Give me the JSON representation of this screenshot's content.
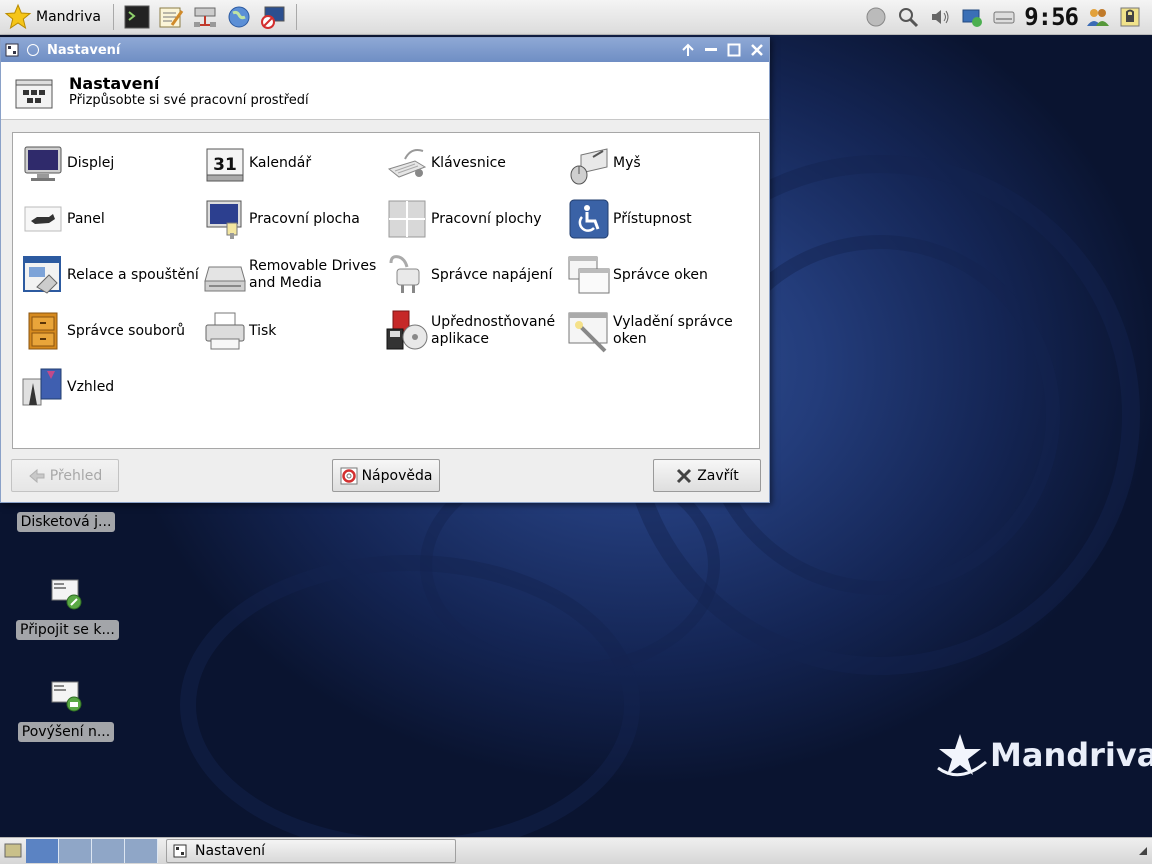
{
  "top_panel": {
    "menu_label": "Mandriva",
    "launchers": [
      "terminal-icon",
      "text-editor-icon",
      "network-tool-icon",
      "web-browser-icon",
      "remote-desktop-icon"
    ],
    "tray_icons": [
      "network-status-icon",
      "search-icon",
      "volume-icon",
      "updates-icon",
      "drive-icon"
    ],
    "clock": "9:56",
    "extra_tray": [
      "users-icon",
      "lock-screen-icon"
    ]
  },
  "window": {
    "title": "Nastavení",
    "header_title": "Nastavení",
    "header_subtitle": "Přizpůsobte si své pracovní prostředí",
    "items": [
      {
        "label": "Displej",
        "icon": "display-icon"
      },
      {
        "label": "Kalendář",
        "icon": "calendar-icon",
        "icon_text": "31"
      },
      {
        "label": "Klávesnice",
        "icon": "keyboard-icon"
      },
      {
        "label": "Myš",
        "icon": "mouse-icon"
      },
      {
        "label": "Panel",
        "icon": "panel-icon"
      },
      {
        "label": "Pracovní plocha",
        "icon": "desktop-icon"
      },
      {
        "label": "Pracovní plochy",
        "icon": "workspaces-icon"
      },
      {
        "label": "Přístupnost",
        "icon": "accessibility-icon"
      },
      {
        "label": "Relace a spouštění",
        "icon": "session-icon"
      },
      {
        "label": "Removable Drives and Media",
        "icon": "removable-drive-icon"
      },
      {
        "label": "Správce napájení",
        "icon": "power-plug-icon"
      },
      {
        "label": "Správce oken",
        "icon": "window-manager-icon"
      },
      {
        "label": "Správce souborů",
        "icon": "file-cabinet-icon"
      },
      {
        "label": "Tisk",
        "icon": "printer-icon"
      },
      {
        "label": "Upřednostňované aplikace",
        "icon": "preferred-apps-icon"
      },
      {
        "label": "Vyladění správce oken",
        "icon": "wm-tweaks-icon"
      },
      {
        "label": "Vzhled",
        "icon": "appearance-icon"
      }
    ],
    "buttons": {
      "overview": "Přehled",
      "help": "Nápověda",
      "close": "Zavřít"
    }
  },
  "desktop_icons": [
    {
      "label": "Disketová j...",
      "icon": "floppy-icon"
    },
    {
      "label": "Připojit se k...",
      "icon": "connect-icon"
    },
    {
      "label": "Povýšení n...",
      "icon": "upgrade-icon"
    }
  ],
  "brand": "Mandriva",
  "taskbar": {
    "task_label": "Nastavení",
    "workspaces": 4
  },
  "colors": {
    "titlebar": "#7b98cc",
    "desktop_blue": "#233c7a",
    "accent": "#5b83c3"
  }
}
